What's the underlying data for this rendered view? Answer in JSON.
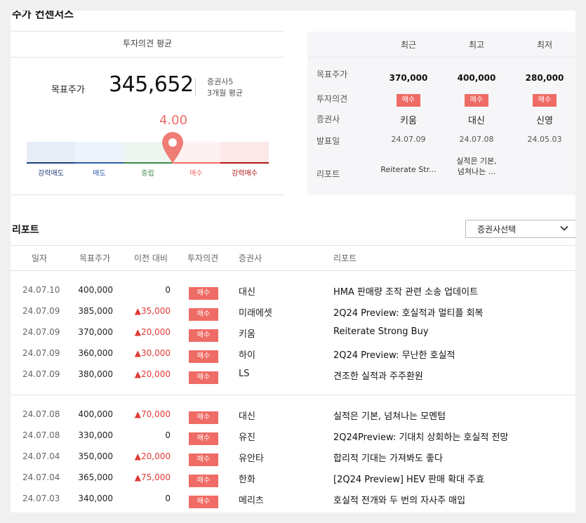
{
  "section_title": "주가 컨센서스",
  "consensus": {
    "avg_label": "투자의견 평균",
    "target_label": "목표주가",
    "target_value": "345,652",
    "brokers_count": "증권사5",
    "period": "3개월 평균",
    "score": "4.00",
    "score_value": 4.0,
    "gauge": [
      {
        "label": "강력매도",
        "fill": "#e8eef8",
        "line": "#1f3f7a",
        "text": "#1f3f7a"
      },
      {
        "label": "매도",
        "fill": "#eef3fb",
        "line": "#2f5fb0",
        "text": "#2f5fb0"
      },
      {
        "label": "중립",
        "fill": "#eef6ef",
        "line": "#3a8a47",
        "text": "#3a8a47"
      },
      {
        "label": "매수",
        "fill": "#fdf1f1",
        "line": "#ef6b65",
        "text": "#ef6b65"
      },
      {
        "label": "강력매수",
        "fill": "#fbe8e8",
        "line": "#b3151b",
        "text": "#b3151b"
      }
    ]
  },
  "recent_table": {
    "headers": [
      "최근",
      "최고",
      "최저"
    ],
    "row_labels": [
      "목표주가",
      "투자의견",
      "증권사",
      "발표일",
      "리포트"
    ],
    "columns": [
      {
        "price": "370,000",
        "opinion": "매수",
        "broker": "키움",
        "date": "24.07.09",
        "report": [
          "Reiterate Str..."
        ]
      },
      {
        "price": "400,000",
        "opinion": "매수",
        "broker": "대신",
        "date": "24.07.08",
        "report": [
          "실적은 기본,",
          "넘쳐나는 ..."
        ]
      },
      {
        "price": "280,000",
        "opinion": "매수",
        "broker": "신영",
        "date": "24.05.03",
        "report": []
      }
    ]
  },
  "reports": {
    "title": "리포트",
    "select_label": "증권사선택",
    "headers": {
      "date": "일자",
      "price": "목표주가",
      "change": "이전 대비",
      "opinion": "투자의견",
      "broker": "증권사",
      "report": "리포트"
    },
    "groups": [
      [
        {
          "date": "24.07.10",
          "price": "400,000",
          "change": "0",
          "up": false,
          "opinion": "매수",
          "broker": "대신",
          "title": "HMA 판매량 조작 관련 소송 업데이트"
        },
        {
          "date": "24.07.09",
          "price": "385,000",
          "change": "▲35,000",
          "up": true,
          "opinion": "매수",
          "broker": "미래에셋",
          "title": "2Q24 Preview: 호실적과 멀티플 회복"
        },
        {
          "date": "24.07.09",
          "price": "370,000",
          "change": "▲20,000",
          "up": true,
          "opinion": "매수",
          "broker": "키움",
          "title": "Reiterate Strong Buy"
        },
        {
          "date": "24.07.09",
          "price": "360,000",
          "change": "▲30,000",
          "up": true,
          "opinion": "매수",
          "broker": "하이",
          "title": "2Q24 Preview: 무난한 호실적"
        },
        {
          "date": "24.07.09",
          "price": "380,000",
          "change": "▲20,000",
          "up": true,
          "opinion": "매수",
          "broker": "LS",
          "title": "견조한 실적과 주주환원"
        }
      ],
      [
        {
          "date": "24.07.08",
          "price": "400,000",
          "change": "▲70,000",
          "up": true,
          "opinion": "매수",
          "broker": "대신",
          "title": "실적은 기본, 넘쳐나는 모멘텀"
        },
        {
          "date": "24.07.08",
          "price": "330,000",
          "change": "0",
          "up": false,
          "opinion": "매수",
          "broker": "유진",
          "title": "2Q24Preview: 기대치 상회하는 호실적 전망"
        },
        {
          "date": "24.07.04",
          "price": "350,000",
          "change": "▲20,000",
          "up": true,
          "opinion": "매수",
          "broker": "유안타",
          "title": "합리적 기대는 가져봐도 좋다"
        },
        {
          "date": "24.07.04",
          "price": "365,000",
          "change": "▲75,000",
          "up": true,
          "opinion": "매수",
          "broker": "한화",
          "title": "[2Q24 Preview] HEV 판매 확대 주효"
        },
        {
          "date": "24.07.03",
          "price": "340,000",
          "change": "0",
          "up": false,
          "opinion": "매수",
          "broker": "메리츠",
          "title": "호실적 전개와 두 번의 자사주 매입"
        }
      ]
    ]
  },
  "colors": {
    "accent": "#ef6b65",
    "up": "#e03a35"
  }
}
